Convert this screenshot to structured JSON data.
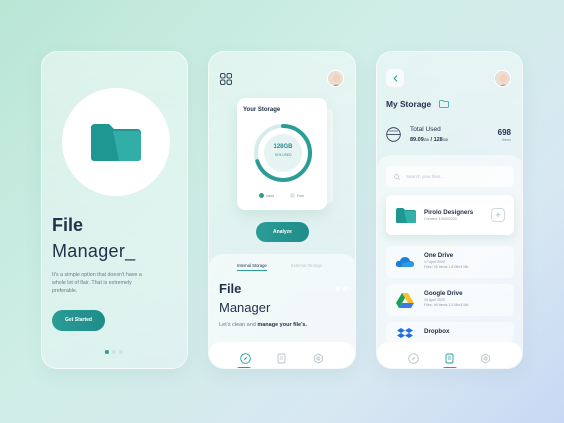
{
  "colors": {
    "accent": "#2b9c96",
    "dark_text": "#23324b",
    "muted": "#6a7a8a"
  },
  "screen1": {
    "title_line1": "File",
    "title_line2": "Manager_",
    "description": "It's a simple option that doesn't have a whole lot of flair. That is extremely preferable.",
    "button": "Get Started",
    "icon": "folder-icon"
  },
  "screen2": {
    "storage_card": {
      "title": "Your Storage",
      "value": "128GB",
      "sub": "70% USED",
      "used_fraction": 0.7,
      "legend": [
        "Used",
        "Free"
      ]
    },
    "analyze_button": "Analyze",
    "tabs": [
      "Internal Storage",
      "External Storage"
    ],
    "title_line1": "File",
    "title_line2": "Manager",
    "desc_prefix": "Let's clean and ",
    "desc_bold": "manage your file's.",
    "nav": [
      "compass-icon",
      "files-icon",
      "settings-icon"
    ]
  },
  "screen3": {
    "title": "My Storage",
    "total_used_label": "Total Used",
    "total_used_value": "89.09",
    "total_used_unit": "GB",
    "total_capacity": "128",
    "total_capacity_unit": "GB",
    "items_count": "698",
    "items_label": "Items",
    "search_placeholder": "Search your files...",
    "files": [
      {
        "name": "Pirolo Designers",
        "sub": "Created: 10/02/2020",
        "icon": "folder-icon"
      },
      {
        "name": "One Drive",
        "sub1": "17 April 2020",
        "sub2": "Files: 76 Items 1.8 Mb/4 Mb",
        "icon": "onedrive-icon"
      },
      {
        "name": "Google Drive",
        "sub1": "19 April 2020",
        "sub2": "Files: 46 Items 1.5 Mb/4 Mb",
        "icon": "google-drive-icon"
      },
      {
        "name": "Dropbox",
        "icon": "dropbox-icon"
      }
    ]
  }
}
